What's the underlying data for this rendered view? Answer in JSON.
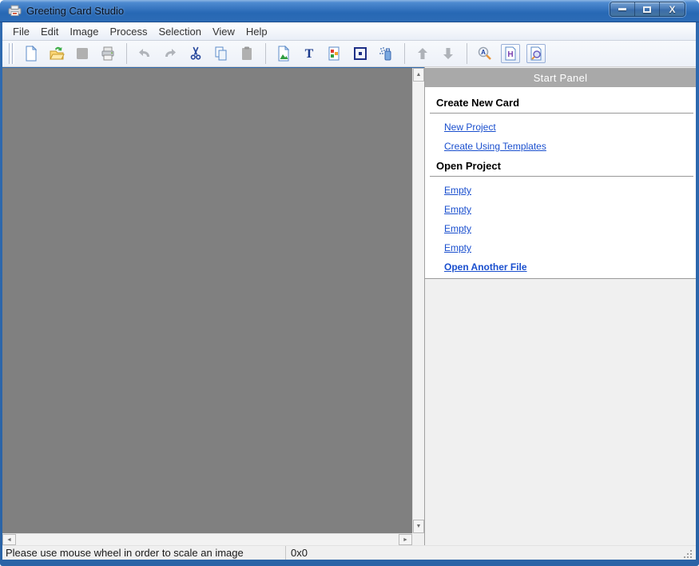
{
  "window": {
    "title": "Greeting Card Studio",
    "controls": [
      {
        "name": "minimize"
      },
      {
        "name": "maximize"
      },
      {
        "name": "close"
      }
    ]
  },
  "menu_bar": {
    "items": [
      "File",
      "Edit",
      "Image",
      "Process",
      "Selection",
      "View",
      "Help"
    ]
  },
  "toolbar": {
    "buttons": [
      {
        "icon": "new-document",
        "enabled": true,
        "pressed": false,
        "group_end": false
      },
      {
        "icon": "open-file",
        "enabled": true,
        "pressed": false,
        "group_end": false
      },
      {
        "icon": "save",
        "enabled": false,
        "pressed": false,
        "group_end": false
      },
      {
        "icon": "print",
        "enabled": true,
        "pressed": false,
        "group_end": true
      },
      {
        "icon": "undo",
        "enabled": false,
        "pressed": false,
        "group_end": false
      },
      {
        "icon": "redo",
        "enabled": false,
        "pressed": false,
        "group_end": false
      },
      {
        "icon": "cut",
        "enabled": true,
        "pressed": false,
        "group_end": false
      },
      {
        "icon": "copy",
        "enabled": true,
        "pressed": false,
        "group_end": false
      },
      {
        "icon": "paste",
        "enabled": false,
        "pressed": false,
        "group_end": true
      },
      {
        "icon": "insert-image",
        "enabled": true,
        "pressed": false,
        "group_end": false
      },
      {
        "icon": "insert-text",
        "enabled": true,
        "pressed": false,
        "group_end": false
      },
      {
        "icon": "insert-shapes",
        "enabled": true,
        "pressed": false,
        "group_end": false
      },
      {
        "icon": "frame",
        "enabled": true,
        "pressed": false,
        "group_end": false
      },
      {
        "icon": "spray",
        "enabled": true,
        "pressed": false,
        "group_end": true
      },
      {
        "icon": "move-up",
        "enabled": false,
        "pressed": false,
        "group_end": false
      },
      {
        "icon": "move-down",
        "enabled": false,
        "pressed": false,
        "group_end": true
      },
      {
        "icon": "font-zoom",
        "enabled": true,
        "pressed": false,
        "group_end": false
      },
      {
        "icon": "start-panel-toggle",
        "enabled": true,
        "pressed": true,
        "group_end": false
      },
      {
        "icon": "preview",
        "enabled": true,
        "pressed": true,
        "group_end": false
      }
    ]
  },
  "start_panel": {
    "title": "Start Panel",
    "sections": [
      {
        "heading": "Create New Card",
        "links": [
          {
            "label": "New Project",
            "bold": false
          },
          {
            "label": "Create Using Templates",
            "bold": false
          }
        ]
      },
      {
        "heading": "Open Project",
        "links": [
          {
            "label": "Empty",
            "bold": false
          },
          {
            "label": "Empty",
            "bold": false
          },
          {
            "label": "Empty",
            "bold": false
          },
          {
            "label": "Empty",
            "bold": false
          },
          {
            "label": "Open Another File",
            "bold": true
          }
        ]
      }
    ]
  },
  "status_bar": {
    "message": "Please use mouse wheel in order to scale an image",
    "size_indicator": "0x0"
  },
  "scrollbars": {
    "vertical": {
      "up_arrow": "▲",
      "down_arrow": "▼"
    },
    "horizontal": {
      "left_arrow": "◄",
      "right_arrow": "►"
    }
  },
  "colors": {
    "canvas_background": "#808080",
    "panel_header_background": "#a9a9a9",
    "link": "#1a4fce",
    "titlebar_blue": "#2e6cb4"
  }
}
